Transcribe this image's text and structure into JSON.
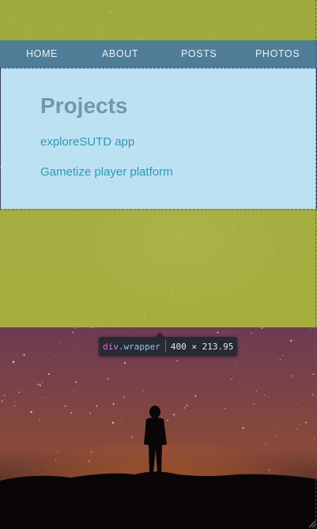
{
  "nav": {
    "items": [
      "HOME",
      "ABOUT",
      "POSTS",
      "PHOTOS"
    ]
  },
  "section": {
    "title": "Projects",
    "links": [
      "exploreSUTD app",
      "Gametize player platform"
    ]
  },
  "inspector": {
    "tag": "div",
    "class": ".wrapper",
    "dimensions": "400 × 213.95"
  },
  "colors": {
    "nav_bg": "#4f7d97",
    "highlight_padding": "#afbe3c",
    "highlight_content": "#bce1f3",
    "title": "#6f98ad",
    "link": "#2f9ab4"
  }
}
